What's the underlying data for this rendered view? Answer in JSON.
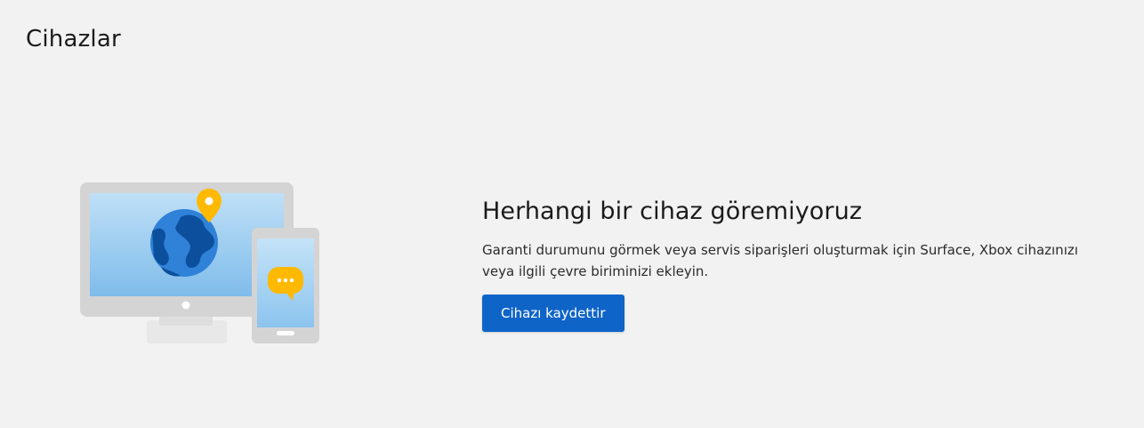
{
  "page": {
    "title": "Cihazlar"
  },
  "empty_state": {
    "heading": "Herhangi bir cihaz göremiyoruz",
    "description": "Garanti durumunu görmek veya servis siparişleri oluşturmak için Surface, Xbox cihazınızı veya ilgili çevre biriminizi ekleyin.",
    "button_label": "Cihazı kaydettir",
    "illustration": {
      "icons": [
        "monitor-icon",
        "globe-icon",
        "location-pin-icon",
        "phone-icon",
        "chat-bubble-icon"
      ]
    }
  },
  "colors": {
    "background": "#f2f2f2",
    "accent": "#0f64c8",
    "pin": "#ffb900"
  }
}
